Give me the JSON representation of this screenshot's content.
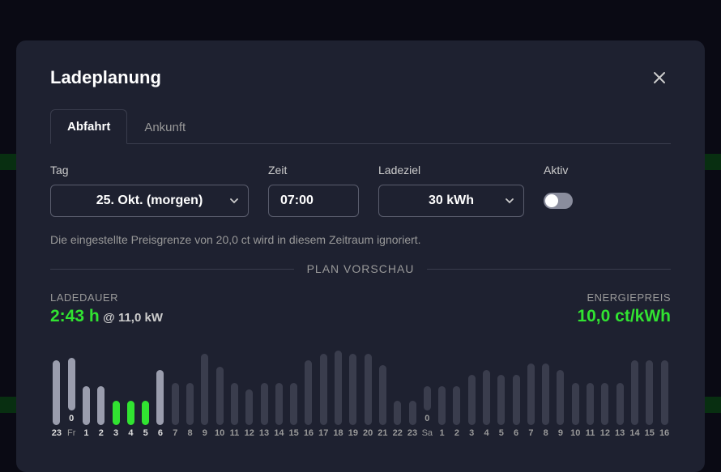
{
  "header": {
    "title": "Ladeplanung"
  },
  "tabs": {
    "departure": "Abfahrt",
    "arrival": "Ankunft"
  },
  "form": {
    "day": {
      "label": "Tag",
      "value": "25. Okt. (morgen)"
    },
    "time": {
      "label": "Zeit",
      "value": "07:00"
    },
    "target": {
      "label": "Ladeziel",
      "value": "30 kWh"
    },
    "active": {
      "label": "Aktiv"
    }
  },
  "info": "Die eingestellte Preisgrenze von 20,0 ct wird in diesem Zeitraum ignoriert.",
  "preview": {
    "heading": "PLAN VORSCHAU"
  },
  "stats": {
    "duration": {
      "label": "LADEDAUER",
      "value": "2:43 h",
      "sub": "@ 11,0 kW"
    },
    "price": {
      "label": "ENERGIEPREIS",
      "value": "10,0 ct/kWh"
    }
  },
  "chart_data": {
    "type": "bar",
    "xlabel": "",
    "ylabel": "",
    "title": "",
    "categories": [
      "23",
      "0",
      "1",
      "2",
      "3",
      "4",
      "5",
      "6",
      "7",
      "8",
      "9",
      "10",
      "11",
      "12",
      "13",
      "14",
      "15",
      "16",
      "17",
      "18",
      "19",
      "20",
      "21",
      "22",
      "23",
      "0",
      "1",
      "2",
      "3",
      "4",
      "5",
      "6",
      "7",
      "8",
      "9",
      "10",
      "11",
      "12",
      "13",
      "14",
      "15",
      "16"
    ],
    "day_markers": {
      "1": "Fr",
      "25": "Sa"
    },
    "values": [
      80,
      65,
      48,
      48,
      30,
      30,
      30,
      68,
      52,
      52,
      88,
      72,
      52,
      44,
      52,
      52,
      52,
      80,
      88,
      92,
      88,
      88,
      74,
      30,
      30,
      30,
      48,
      48,
      62,
      68,
      62,
      62,
      76,
      76,
      68,
      52,
      52,
      52,
      52,
      80,
      80,
      80
    ],
    "states": [
      "current",
      "current",
      "current",
      "current",
      "active",
      "active",
      "active",
      "current",
      "dim",
      "dim",
      "dim",
      "dim",
      "dim",
      "dim",
      "dim",
      "dim",
      "dim",
      "dim",
      "dim",
      "dim",
      "dim",
      "dim",
      "dim",
      "dim",
      "dim",
      "dim",
      "dim",
      "dim",
      "dim",
      "dim",
      "dim",
      "dim",
      "dim",
      "dim",
      "dim",
      "dim",
      "dim",
      "dim",
      "dim",
      "dim",
      "dim",
      "dim"
    ]
  }
}
